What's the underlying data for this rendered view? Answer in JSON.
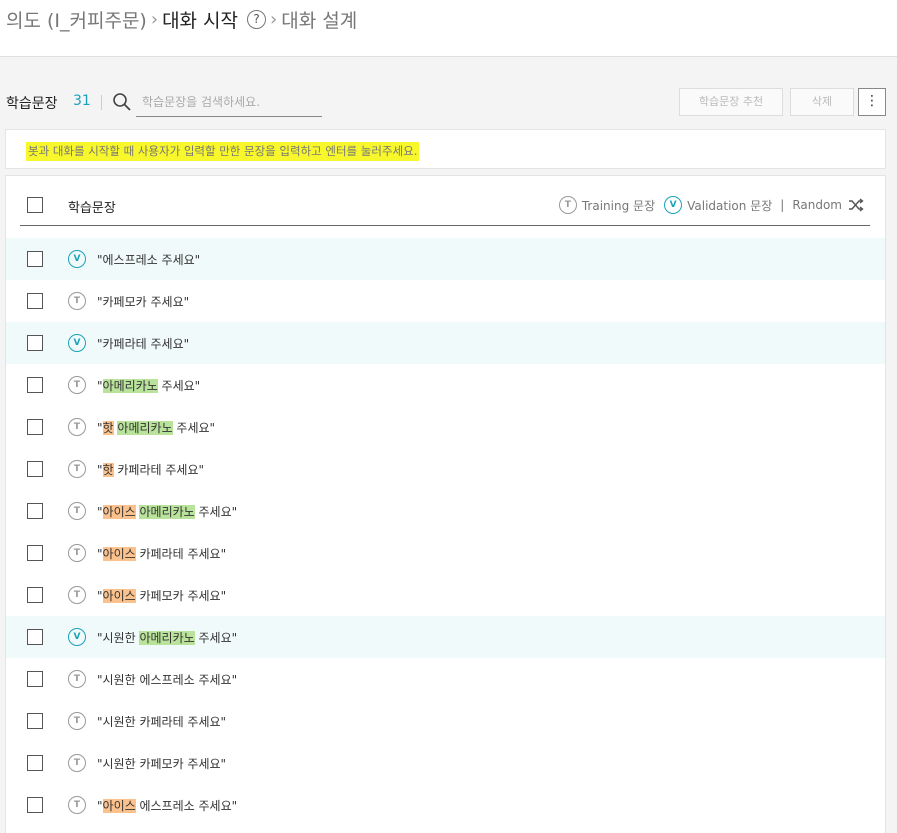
{
  "breadcrumb": {
    "intent": "의도 (I_커피주문)",
    "current": "대화 시작",
    "help_icon": "?",
    "next": "대화 설계"
  },
  "toolbar": {
    "title": "학습문장",
    "count": "31",
    "search_placeholder": "학습문장을 검색하세요.",
    "recommend_label": "학습문장 추천",
    "delete_label": "삭제",
    "more_icon": "⋮"
  },
  "notice": {
    "text": "봇과 대화를 시작할 때 사용자가 입력할 만한 문장을 입력하고 엔터를 눌러주세요."
  },
  "table": {
    "header_label": "학습문장",
    "legend": {
      "training_badge": "T",
      "training_label": "Training 문장",
      "validation_badge": "V",
      "validation_label": "Validation 문장",
      "separator": "|",
      "random_label": "Random"
    },
    "rows": [
      {
        "type": "V",
        "segments": [
          {
            "text": "\"에스프레소 주세요\"",
            "hl": ""
          }
        ]
      },
      {
        "type": "T",
        "segments": [
          {
            "text": "\"카페모카 주세요\"",
            "hl": ""
          }
        ]
      },
      {
        "type": "V",
        "segments": [
          {
            "text": "\"카페라테 주세요\"",
            "hl": ""
          }
        ]
      },
      {
        "type": "T",
        "segments": [
          {
            "text": "\"",
            "hl": ""
          },
          {
            "text": "아메리카노",
            "hl": "g"
          },
          {
            "text": " 주세요\"",
            "hl": ""
          }
        ]
      },
      {
        "type": "T",
        "segments": [
          {
            "text": "\"",
            "hl": ""
          },
          {
            "text": "핫",
            "hl": "o"
          },
          {
            "text": " ",
            "hl": ""
          },
          {
            "text": "아메리카노",
            "hl": "g"
          },
          {
            "text": " 주세요\"",
            "hl": ""
          }
        ]
      },
      {
        "type": "T",
        "segments": [
          {
            "text": "\"",
            "hl": ""
          },
          {
            "text": "핫",
            "hl": "o"
          },
          {
            "text": " 카페라테 주세요\"",
            "hl": ""
          }
        ]
      },
      {
        "type": "T",
        "segments": [
          {
            "text": "\"",
            "hl": ""
          },
          {
            "text": "아이스",
            "hl": "o"
          },
          {
            "text": " ",
            "hl": ""
          },
          {
            "text": "아메리카노",
            "hl": "g"
          },
          {
            "text": " 주세요\"",
            "hl": ""
          }
        ]
      },
      {
        "type": "T",
        "segments": [
          {
            "text": "\"",
            "hl": ""
          },
          {
            "text": "아이스",
            "hl": "o"
          },
          {
            "text": " 카페라테 주세요\"",
            "hl": ""
          }
        ]
      },
      {
        "type": "T",
        "segments": [
          {
            "text": "\"",
            "hl": ""
          },
          {
            "text": "아이스",
            "hl": "o"
          },
          {
            "text": " 카페모카 주세요\"",
            "hl": ""
          }
        ]
      },
      {
        "type": "V",
        "segments": [
          {
            "text": "\"시원한 ",
            "hl": ""
          },
          {
            "text": "아메리카노",
            "hl": "g"
          },
          {
            "text": " 주세요\"",
            "hl": ""
          }
        ]
      },
      {
        "type": "T",
        "segments": [
          {
            "text": "\"시원한 에스프레소 주세요\"",
            "hl": ""
          }
        ]
      },
      {
        "type": "T",
        "segments": [
          {
            "text": "\"시원한 카페라테 주세요\"",
            "hl": ""
          }
        ]
      },
      {
        "type": "T",
        "segments": [
          {
            "text": "\"시원한 카페모카 주세요\"",
            "hl": ""
          }
        ]
      },
      {
        "type": "T",
        "segments": [
          {
            "text": "\"",
            "hl": ""
          },
          {
            "text": "아이스",
            "hl": "o"
          },
          {
            "text": " 에스프레소 주세요\"",
            "hl": ""
          }
        ]
      }
    ]
  },
  "colors": {
    "accent": "#1aa3b8",
    "notice_highlight": "#f7f72b",
    "menu_highlight": "#b9e39a",
    "option_highlight": "#fbc28d",
    "validation_row_bg": "#f0fafa"
  }
}
